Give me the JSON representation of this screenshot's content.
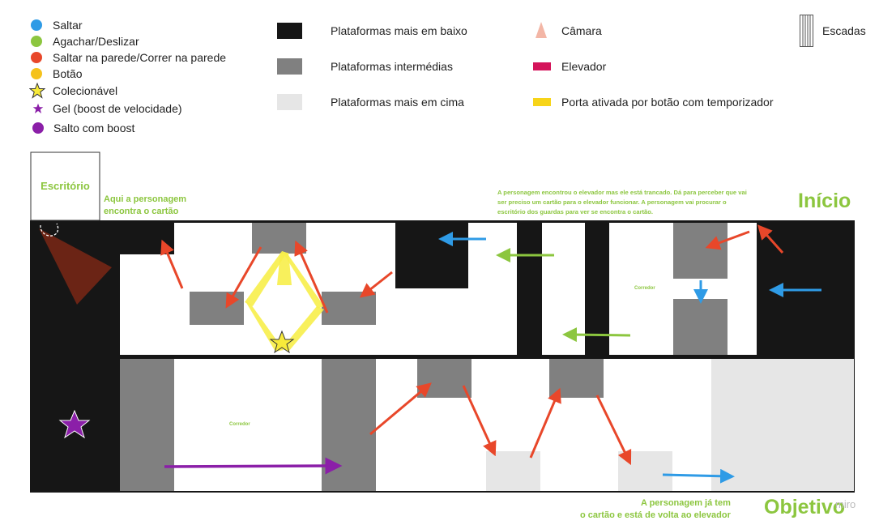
{
  "legend": {
    "actions": [
      {
        "label": "Saltar",
        "color": "#2f9be6"
      },
      {
        "label": "Agachar/Deslizar",
        "color": "#8cc63f"
      },
      {
        "label": "Saltar na parede/Correr na parede",
        "color": "#e8472a"
      },
      {
        "label": "Botão",
        "color": "#f5c21b"
      }
    ],
    "collectible": "Colecionável",
    "gel": "Gel (boost de velocidade)",
    "boost_jump": "Salto com boost",
    "platform_low": "Plataformas mais em baixo",
    "platform_mid": "Plataformas intermédias",
    "platform_high": "Plataformas mais em cima",
    "camera": "Câmara",
    "elevator": "Elevador",
    "timed_door": "Porta ativada por botão com temporizador",
    "stairs": "Escadas"
  },
  "colors": {
    "platform_low": "#161616",
    "platform_mid": "#808080",
    "platform_high": "#e6e6e6",
    "jump": "#2f9be6",
    "crouch": "#8cc63f",
    "wall": "#e8472a",
    "button": "#f5c21b",
    "boost": "#8b1fa8",
    "camera": "#f3b6a6",
    "elevator": "#d4145a",
    "door": "#f7d419",
    "accent_green": "#8cc63f"
  },
  "map": {
    "office_label": "Escritório",
    "card_note": "Aqui a personagem\nencontra o cartão",
    "start_note": "A personagem encontrou o elevador mas ele está trancado. Dá para perceber que vai\nser preciso um cartão para o elevador funcionar. A personagem vai procurar o\nescritório dos guardas para ver se encontra o cartão.",
    "start_label": "Início",
    "corridor_upper": "Corredor",
    "corridor_lower": "Corredor",
    "goal_note": "A personagem já tem\no cartão e está de volta ao elevador",
    "goal_label": "Objetivo",
    "watermark": "miro"
  }
}
